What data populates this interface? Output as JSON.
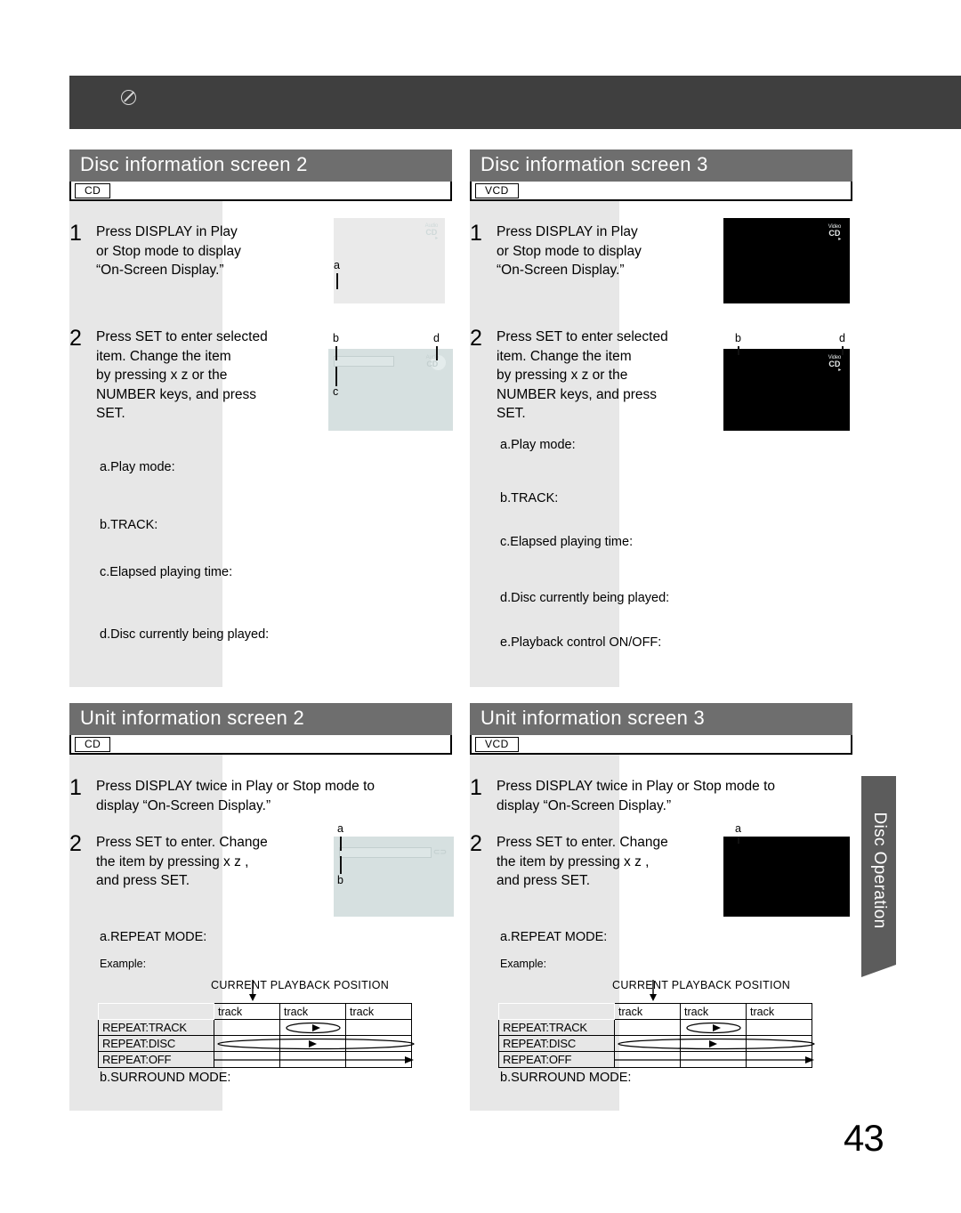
{
  "page": {
    "number": "43",
    "side_tab_label": "Disc Operation",
    "top_bar_icon": "no-entry-icon"
  },
  "panels": [
    {
      "id": "disc-info-2",
      "title": "Disc information screen 2",
      "disc_tag": "CD",
      "steps": [
        {
          "num": "1",
          "text": "Press DISPLAY in Play\nor Stop mode to display\n“On-Screen Display.”"
        },
        {
          "num": "2",
          "text": "Press SET to enter selected\nitem. Change the item\nby pressing  x z  or the\nNUMBER keys, and press\nSET."
        }
      ],
      "items": [
        "a.Play mode:",
        "b.TRACK:",
        "c.Elapsed playing time:",
        "d.Disc currently being played:"
      ],
      "callouts_shot1": [
        "a"
      ],
      "callouts_shot2": [
        "b",
        "c",
        "d"
      ],
      "logo1": {
        "l1": "Audio",
        "l2": "CD",
        "l3": "▸"
      },
      "logo2": {
        "l1": "Audio",
        "l2": "CD",
        "l3": "▸"
      }
    },
    {
      "id": "disc-info-3",
      "title": "Disc information screen 3",
      "disc_tag": "VCD",
      "steps": [
        {
          "num": "1",
          "text": "Press DISPLAY in Play\nor Stop mode to display\n“On-Screen Display.”"
        },
        {
          "num": "2",
          "text": "Press SET to enter selected\nitem. Change the item\nby pressing  x z  or the\nNUMBER keys, and press\nSET."
        }
      ],
      "items": [
        "a.Play mode:",
        "b.TRACK:",
        "c.Elapsed playing time:",
        "d.Disc currently being played:",
        "e.Playback control ON/OFF:"
      ],
      "callouts_shot2": [
        "b",
        "d"
      ],
      "logo1": {
        "l1": "Video",
        "l2": "CD",
        "l3": "▸"
      },
      "logo2": {
        "l1": "Video",
        "l2": "CD",
        "l3": "▸"
      }
    },
    {
      "id": "unit-info-2",
      "title": "Unit information screen 2",
      "disc_tag": "CD",
      "steps": [
        {
          "num": "1",
          "text": "Press DISPLAY twice in Play or Stop mode  to\ndisplay “On-Screen Display.”"
        },
        {
          "num": "2",
          "text": "Press SET to enter. Change\nthe item by pressing  x z ,\nand press SET."
        }
      ],
      "items": [
        "a.REPEAT MODE:",
        "b.SURROUND MODE:"
      ],
      "callouts_shot": [
        "a",
        "b"
      ],
      "example_label": "Example:",
      "logo": {
        "l1": "",
        "l2": "⊂⊃",
        "l3": ""
      }
    },
    {
      "id": "unit-info-3",
      "title": "Unit information screen 3",
      "disc_tag": "VCD",
      "steps": [
        {
          "num": "1",
          "text": "Press DISPLAY twice in Play or Stop mode  to\ndisplay “On-Screen Display.”"
        },
        {
          "num": "2",
          "text": "Press SET to enter. Change\nthe item by pressing  x z ,\nand press SET."
        }
      ],
      "items": [
        "a.REPEAT MODE:",
        "b.SURROUND MODE:"
      ],
      "callouts_shot": [
        "a"
      ],
      "example_label": "Example:"
    }
  ],
  "repeat_table": {
    "current_position_label": "CURRENT PLAYBACK POSITION",
    "column_headers": [
      "",
      "track",
      "track",
      "track"
    ],
    "rows": [
      {
        "label": "REPEAT:TRACK",
        "mode": "track"
      },
      {
        "label": "REPEAT:DISC",
        "mode": "disc"
      },
      {
        "label": "REPEAT:OFF",
        "mode": "off"
      }
    ]
  },
  "colors": {
    "title_bar": "#6e6e6e",
    "top_bar": "#3f3f3f",
    "grey_column": "#e7e7e7",
    "side_tab": "#5c5c5c",
    "cd_screen": "#d6e0e0",
    "vcd_screen": "#000000"
  }
}
